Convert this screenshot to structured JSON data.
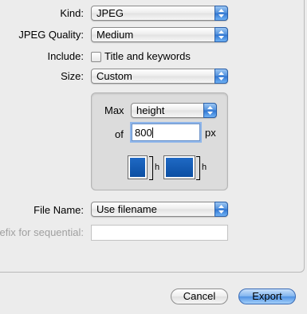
{
  "form": {
    "kind_label": "Kind:",
    "kind_value": "JPEG",
    "quality_label": "JPEG Quality:",
    "quality_value": "Medium",
    "include_label": "Include:",
    "include_option_label": "Title and keywords",
    "include_checked": false,
    "size_label": "Size:",
    "size_value": "Custom"
  },
  "custom_size": {
    "max_label": "Max",
    "dimension_value": "height",
    "of_label": "of",
    "pixels_value": "800",
    "unit_label": "px",
    "h_label_1": "h",
    "h_label_2": "h",
    "swatch_color": "#0d4fa3"
  },
  "filename": {
    "label": "File Name:",
    "value": "Use filename",
    "sequential_label": "Prefix for sequential:",
    "sequential_value": ""
  },
  "buttons": {
    "cancel": "Cancel",
    "export": "Export"
  }
}
